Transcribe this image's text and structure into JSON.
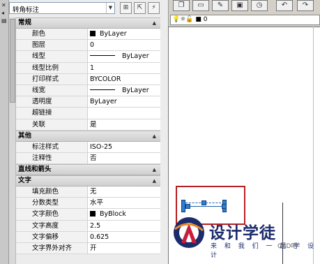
{
  "panel": {
    "selected_object": "转角标注",
    "buttons": [
      "toggle-pickadd",
      "select-objects",
      "quick-select"
    ]
  },
  "sections": [
    {
      "name": "常规",
      "rows": [
        {
          "label": "颜色",
          "value": "ByLayer",
          "swatch": true
        },
        {
          "label": "图层",
          "value": "0"
        },
        {
          "label": "线型",
          "value": "ByLayer",
          "linetype": true
        },
        {
          "label": "线型比例",
          "value": "1"
        },
        {
          "label": "打印样式",
          "value": "BYCOLOR"
        },
        {
          "label": "线宽",
          "value": "ByLayer",
          "linetype": true
        },
        {
          "label": "透明度",
          "value": "ByLayer"
        },
        {
          "label": "超链接",
          "value": ""
        },
        {
          "label": "关联",
          "value": "是"
        }
      ]
    },
    {
      "name": "其他",
      "rows": [
        {
          "label": "标注样式",
          "value": "ISO-25"
        },
        {
          "label": "注释性",
          "value": "否"
        }
      ]
    },
    {
      "name": "直线和箭头",
      "rows": []
    },
    {
      "name": "文字",
      "rows": [
        {
          "label": "填充颜色",
          "value": "无"
        },
        {
          "label": "分数类型",
          "value": "水平"
        },
        {
          "label": "文字颜色",
          "value": "ByBlock",
          "swatch": true
        },
        {
          "label": "文字高度",
          "value": "2.5"
        },
        {
          "label": "文字偏移",
          "value": "0.625"
        },
        {
          "label": "文字界外对齐",
          "value": "开"
        }
      ]
    }
  ],
  "layer_bar": {
    "icons": "💡☼🔓 ■",
    "layer": "0"
  },
  "watermark": {
    "title": "设计学徒",
    "subtitle": "来 和 我 们 一 起 学 设 计",
    "badge": "CAD吧"
  },
  "colors": {
    "highlight_box": "#b52020",
    "grip": "#2d7fd0",
    "watermark_text": "#1b2b6b"
  }
}
